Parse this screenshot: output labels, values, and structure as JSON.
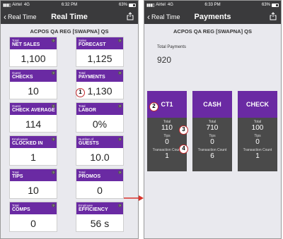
{
  "status": {
    "carrier": "Airtel",
    "network": "4G",
    "time_left": "6:32 PM",
    "time_right": "6:33 PM",
    "battery": "63%"
  },
  "left": {
    "back_label": "Real Time",
    "title": "Real Time",
    "store": "ACPOS QA REG [SWAPNA] QS",
    "tiles": [
      {
        "small": "Total",
        "big": "NET SALES",
        "value": "1,100"
      },
      {
        "small": "Sales",
        "big": "FORECAST",
        "value": "1,125"
      },
      {
        "small": "Guest",
        "big": "CHECKS",
        "value": "10"
      },
      {
        "small": "Total",
        "big": "PAYMENTS",
        "value": "1,130"
      },
      {
        "small": "Guest",
        "big": "CHECK AVERAGE",
        "value": "114"
      },
      {
        "small": "Total",
        "big": "LABOR",
        "value": "0%"
      },
      {
        "small": "Employees",
        "big": "CLOCKED IN",
        "value": "1"
      },
      {
        "small": "Number of",
        "big": "GUESTS",
        "value": "10.0"
      },
      {
        "small": "Total",
        "big": "TIPS",
        "value": "10"
      },
      {
        "small": "Total",
        "big": "PROMOS",
        "value": "0"
      },
      {
        "small": "Total",
        "big": "COMPS",
        "value": "0"
      },
      {
        "small": "Employee",
        "big": "EFFICIENCY",
        "value": "56 s"
      }
    ],
    "info_glyph": "?"
  },
  "right": {
    "back_label": "Real Time",
    "title": "Payments",
    "store": "ACPOS QA REG [SWAPNA] QS",
    "total_label": "Total Payments",
    "total_value": "920",
    "labels": {
      "total": "Total",
      "tips": "Tips",
      "count": "Transaction Count"
    },
    "cards": [
      {
        "name": "CT1",
        "total": "110",
        "tips": "0",
        "count": "1"
      },
      {
        "name": "CASH",
        "total": "710",
        "tips": "0",
        "count": "6"
      },
      {
        "name": "CHECK",
        "total": "100",
        "tips": "0",
        "count": "1"
      }
    ]
  },
  "callouts": [
    "1",
    "2",
    "3",
    "4"
  ],
  "colors": {
    "accent": "#6a2aa3",
    "navbar": "#3a3a3c",
    "callout": "#c0282c",
    "card": "#4a4a4a"
  }
}
